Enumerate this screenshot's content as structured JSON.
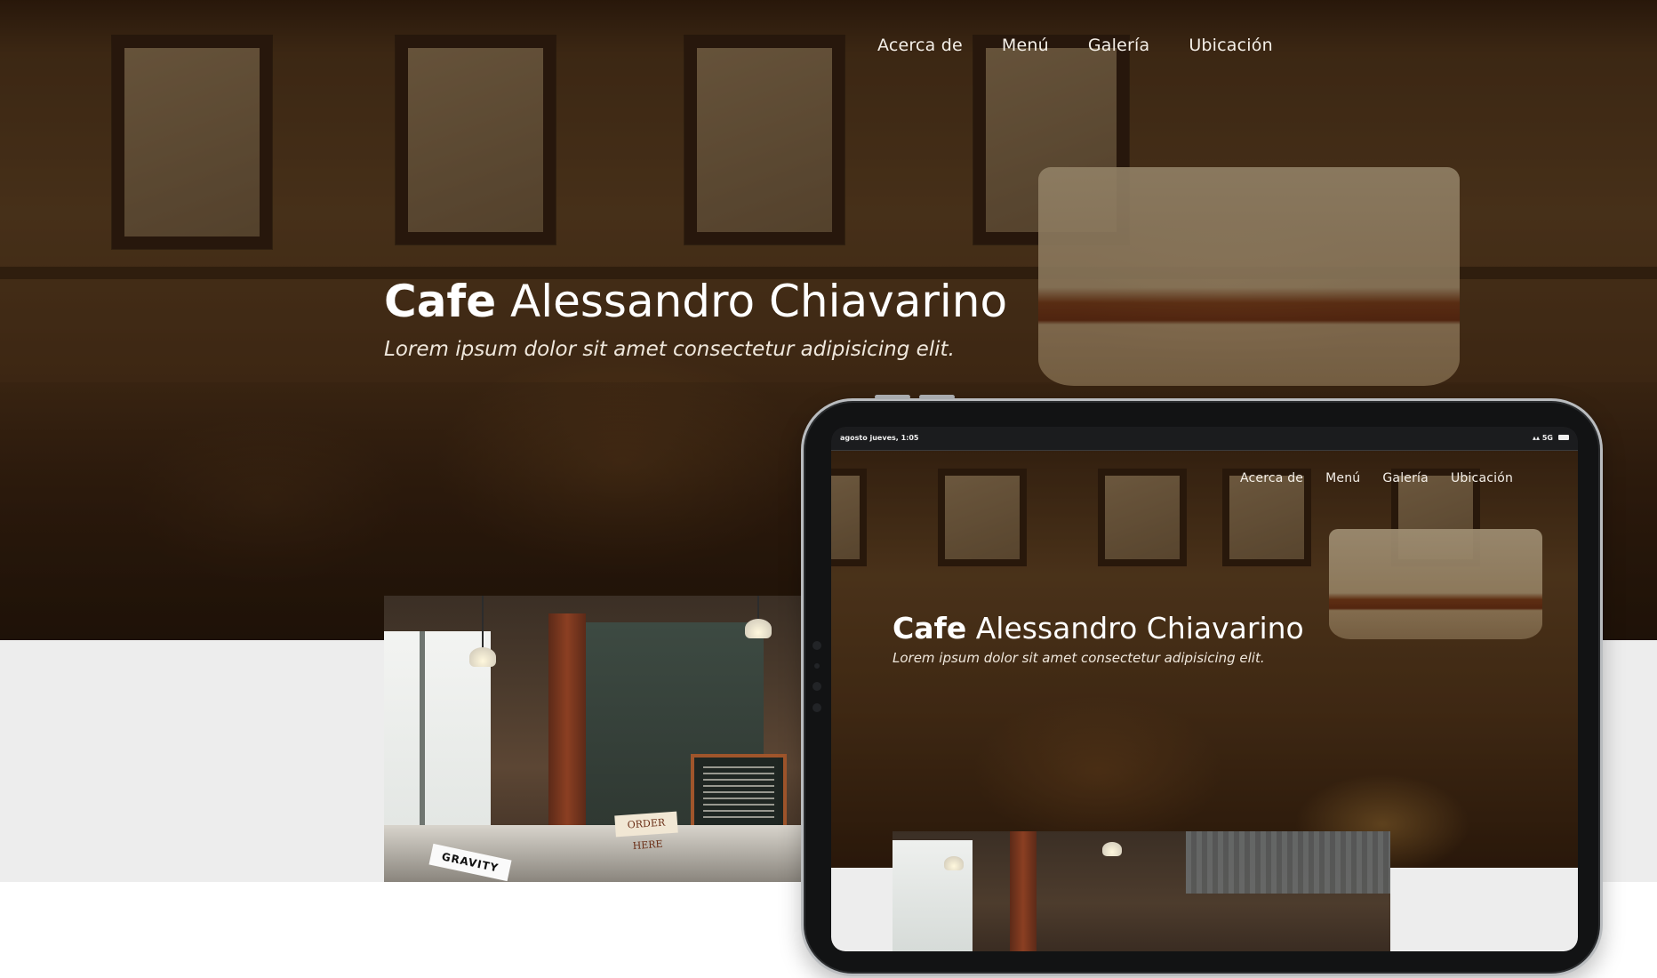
{
  "site": {
    "nav": [
      "Acerca de",
      "Menú",
      "Galería",
      "Ubicación"
    ],
    "title_brand": "Cafe",
    "title_rest": "Alessandro Chiavarino",
    "subtitle": "Lorem ipsum dolor sit amet consectetur adipisicing elit."
  },
  "photo": {
    "sign_text": "ORDER HERE",
    "paper_text": "GRAVITY"
  },
  "tablet": {
    "status_time": "agosto jueves, 1:05",
    "status_network": "5G"
  },
  "colors": {
    "hero_dark": "#3c2412",
    "band_light": "#ededed",
    "tablet_body": "#121314",
    "tablet_rim": "#b9bcbf"
  }
}
